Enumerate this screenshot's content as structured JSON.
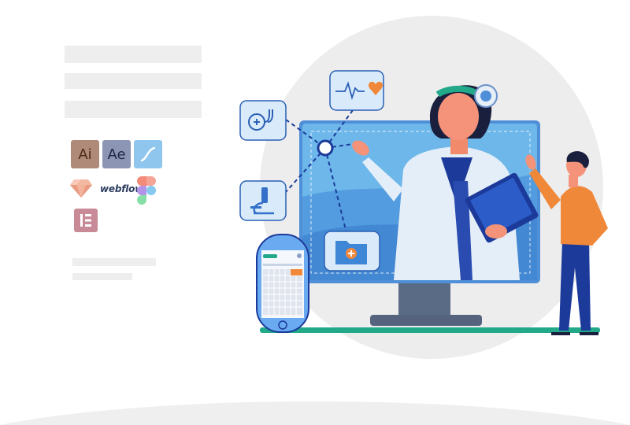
{
  "tools": {
    "illustrator_label": "Ai",
    "after_effects_label": "Ae",
    "webflow_label": "webflow",
    "icons": [
      "illustrator-icon",
      "after-effects-icon",
      "affinity-designer-icon",
      "sketch-icon",
      "webflow-logo",
      "figma-icon",
      "elementor-icon"
    ]
  },
  "colors": {
    "background_circle": "#ededed",
    "monitor_blue": "#5aaee8",
    "accent_teal": "#22a98a",
    "accent_orange": "#f0883a",
    "dark_navy": "#1b3a9a"
  }
}
